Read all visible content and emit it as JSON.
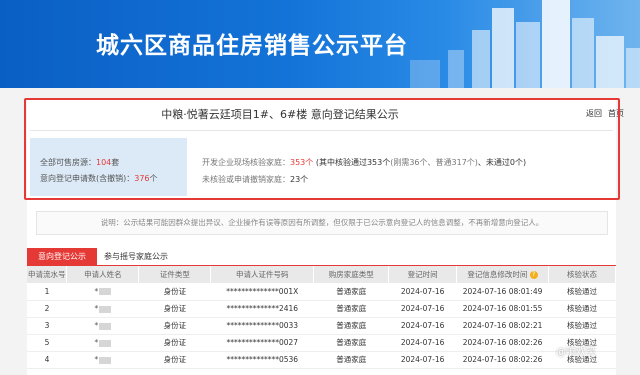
{
  "banner": {
    "title": "城六区商品住房销售公示平台"
  },
  "header": {
    "title": "中粮·悦著云廷项目1#、6#楼 意向登记结果公示",
    "links": [
      "返回",
      "首页"
    ]
  },
  "stats_left": {
    "rooms_label": "全部可售房源：",
    "rooms_value": "104",
    "rooms_unit": "套",
    "apps_label": "意向登记申请数(含撤销)：",
    "apps_value": "376",
    "apps_unit": "个"
  },
  "stats_right": {
    "verify_label": "开发企业现场核验家庭：",
    "verify_value": "353个",
    "verify_detail": "(其中核验通过353个",
    "verify_sub": "(刚需36个、普通317个)",
    "verify_fail": "、未通过0个)",
    "unverified_label": "未核验或申请撤销家庭：",
    "unverified_value": "23个"
  },
  "note": "说明：公示结果可能因群众提出异议、企业操作有误等原因有所调整，但仅限于已公示意向登记人的信息调整，不再新增意向登记人。",
  "tabs": {
    "active": "意向登记公示",
    "inactive": "参与摇号家庭公示"
  },
  "table": {
    "headers": [
      "申请流水号",
      "申请人姓名",
      "证件类型",
      "申请人证件号码",
      "购房家庭类型",
      "登记时间",
      "登记信息修改时间",
      "核验状态"
    ],
    "info_icon": "?",
    "rows": [
      {
        "id": "1",
        "name": "*",
        "idtype": "身份证",
        "idno": "**************001X",
        "family": "普通家庭",
        "reg": "2024-07-16",
        "mod": "2024-07-16 08:01:49",
        "status": "核验通过"
      },
      {
        "id": "2",
        "name": "*",
        "idtype": "身份证",
        "idno": "**************2416",
        "family": "普通家庭",
        "reg": "2024-07-16",
        "mod": "2024-07-16 08:01:55",
        "status": "核验通过"
      },
      {
        "id": "3",
        "name": "*",
        "idtype": "身份证",
        "idno": "**************0033",
        "family": "普通家庭",
        "reg": "2024-07-16",
        "mod": "2024-07-16 08:02:21",
        "status": "核验通过"
      },
      {
        "id": "5",
        "name": "*",
        "idtype": "身份证",
        "idno": "**************0027",
        "family": "普通家庭",
        "reg": "2024-07-16",
        "mod": "2024-07-16 08:02:26",
        "status": "核验通过"
      },
      {
        "id": "4",
        "name": "*",
        "idtype": "身份证",
        "idno": "**************0536",
        "family": "普通家庭",
        "reg": "2024-07-16",
        "mod": "2024-07-16 08:02:26",
        "status": "核验通过"
      }
    ]
  },
  "watermark": "@响欢笑"
}
